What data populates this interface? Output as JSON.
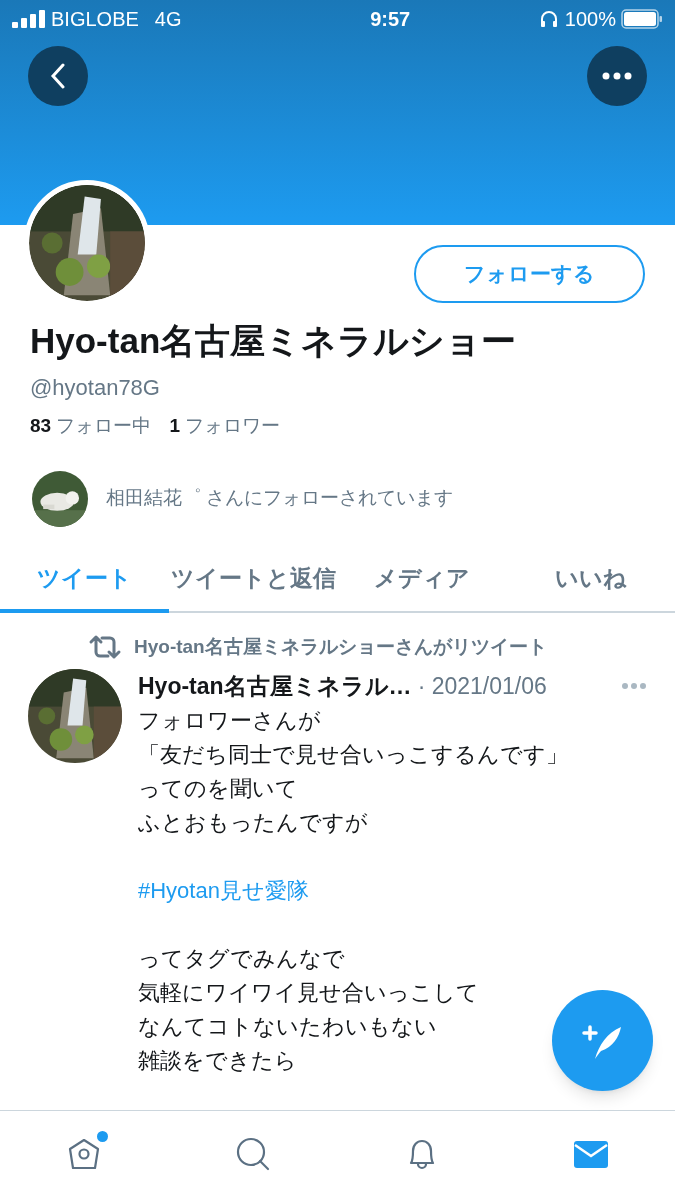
{
  "status_bar": {
    "carrier": "BIGLOBE",
    "network": "4G",
    "time": "9:57",
    "battery": "100%"
  },
  "profile": {
    "name": "Hyo-tan名古屋ミネラルショー",
    "handle": "@hyotan78G",
    "follow_button": "フォローする",
    "stats": [
      {
        "count": "83",
        "label": "フォロー中"
      },
      {
        "count": "1",
        "label": "フォロワー"
      }
    ],
    "followed_by": "相田結花゜ さんにフォローされています"
  },
  "tabs": [
    {
      "label": "ツイート",
      "selected": true
    },
    {
      "label": "ツイートと返信",
      "selected": false
    },
    {
      "label": "メディア",
      "selected": false
    },
    {
      "label": "いいね",
      "selected": false
    }
  ],
  "tweet": {
    "retweeted_by": "Hyo-tan名古屋ミネラルショーさんがリツイート",
    "author": "Hyo-tan名古屋ミネラル…",
    "date": "· 2021/01/06",
    "body": [
      {
        "kind": "text",
        "lines": [
          "フォロワーさんが",
          "「友だち同士で見せ合いっこするんです」",
          "ってのを聞いて",
          "ふとおもったんですが"
        ]
      },
      {
        "kind": "hashtag",
        "lines": [
          "#Hyotan見せ愛隊"
        ]
      },
      {
        "kind": "text",
        "lines": [
          "ってタグでみんなで",
          "気軽にワイワイ見せ合いっこして",
          "なんてコトないたわいもない",
          "雑談をできたら"
        ]
      }
    ]
  },
  "bottom_nav": [
    {
      "kind": "home",
      "selected": false,
      "badge": true
    },
    {
      "kind": "search",
      "selected": false,
      "badge": false
    },
    {
      "kind": "notifications",
      "selected": false,
      "badge": false
    },
    {
      "kind": "messages",
      "selected": true,
      "badge": false
    }
  ]
}
